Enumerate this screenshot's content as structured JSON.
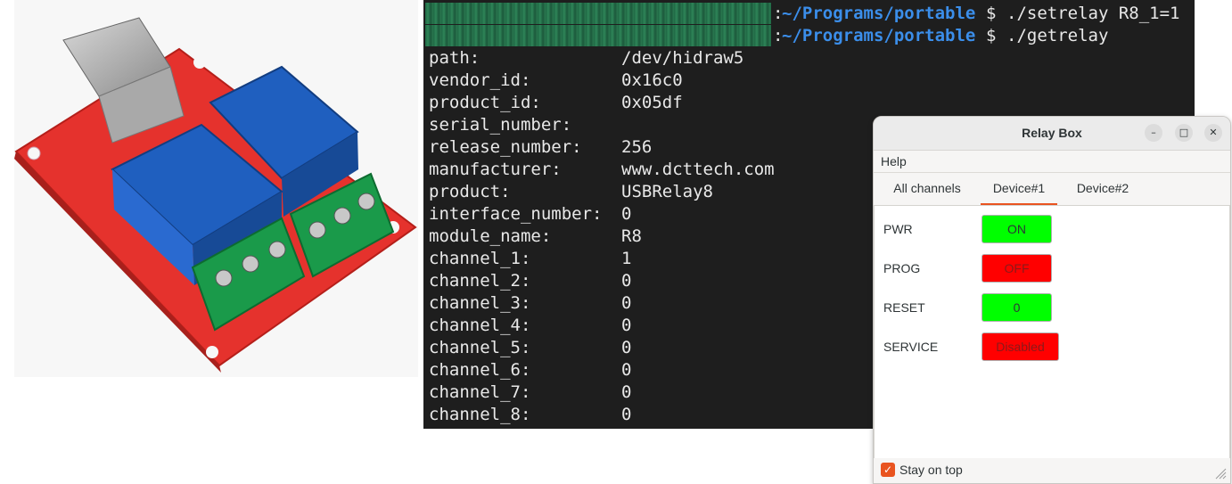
{
  "terminal": {
    "prompts": [
      {
        "colon": ":",
        "path": "~/Programs/portable",
        "dollar": "$",
        "command": "./setrelay R8_1=1"
      },
      {
        "colon": ":",
        "path": "~/Programs/portable",
        "dollar": "$",
        "command": "./getrelay"
      }
    ],
    "output": [
      {
        "key": "path:",
        "value": "/dev/hidraw5"
      },
      {
        "key": "vendor_id:",
        "value": "0x16c0"
      },
      {
        "key": "product_id:",
        "value": "0x05df"
      },
      {
        "key": "serial_number:",
        "value": ""
      },
      {
        "key": "release_number:",
        "value": "256"
      },
      {
        "key": "manufacturer:",
        "value": "www.dcttech.com"
      },
      {
        "key": "product:",
        "value": "USBRelay8"
      },
      {
        "key": "interface_number:",
        "value": "0"
      },
      {
        "key": "module_name:",
        "value": "R8"
      },
      {
        "key": "channel_1:",
        "value": "1"
      },
      {
        "key": "channel_2:",
        "value": "0"
      },
      {
        "key": "channel_3:",
        "value": "0"
      },
      {
        "key": "channel_4:",
        "value": "0"
      },
      {
        "key": "channel_5:",
        "value": "0"
      },
      {
        "key": "channel_6:",
        "value": "0"
      },
      {
        "key": "channel_7:",
        "value": "0"
      },
      {
        "key": "channel_8:",
        "value": "0"
      }
    ]
  },
  "dialog": {
    "title": "Relay Box",
    "window_buttons": {
      "minimize": "–",
      "maximize": "□",
      "close": "✕"
    },
    "menu": {
      "help": "Help"
    },
    "tabs": [
      {
        "label": "All channels",
        "active": false
      },
      {
        "label": "Device#1",
        "active": true
      },
      {
        "label": "Device#2",
        "active": false
      }
    ],
    "rows": [
      {
        "label": "PWR",
        "state": "ON",
        "color": "#00ff00"
      },
      {
        "label": "PROG",
        "state": "OFF",
        "color": "#ff0000"
      },
      {
        "label": "RESET",
        "state": "0",
        "color": "#00ff00"
      },
      {
        "label": "SERVICE",
        "state": "Disabled",
        "color": "#ff0000"
      }
    ],
    "stay_on_top": {
      "label": "Stay on top",
      "checked": true
    },
    "accent": "#e95420"
  }
}
